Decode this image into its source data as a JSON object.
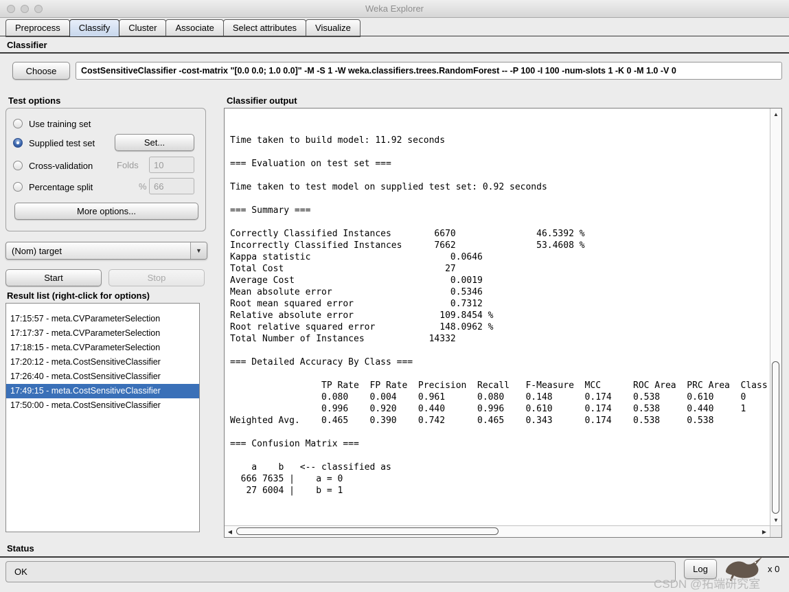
{
  "window": {
    "title": "Weka Explorer"
  },
  "tabs": {
    "items": [
      "Preprocess",
      "Classify",
      "Cluster",
      "Associate",
      "Select attributes",
      "Visualize"
    ],
    "selected": "Classify"
  },
  "classifier": {
    "section_title": "Classifier",
    "choose_label": "Choose",
    "command": "CostSensitiveClassifier -cost-matrix \"[0.0 0.0; 1.0 0.0]\" -M -S 1 -W weka.classifiers.trees.RandomForest -- -P 100 -I 100 -num-slots 1 -K 0 -M 1.0 -V 0"
  },
  "test_options": {
    "title": "Test options",
    "use_training_set": "Use training set",
    "supplied_test_set": "Supplied test set",
    "set_button": "Set...",
    "cross_validation": "Cross-validation",
    "folds_label": "Folds",
    "folds_value": "10",
    "percentage_split": "Percentage split",
    "percent_label": "%",
    "percent_value": "66",
    "more_options_button": "More options...",
    "selected_option": "Supplied test set"
  },
  "target_combo": {
    "value": "(Nom) target"
  },
  "actions": {
    "start_label": "Start",
    "stop_label": "Stop"
  },
  "result_list": {
    "title": "Result list (right-click for options)",
    "selected_index": 5,
    "items": [
      "17:15:57 - meta.CVParameterSelection",
      "17:17:37 - meta.CVParameterSelection",
      "17:18:15 - meta.CVParameterSelection",
      "17:20:12 - meta.CostSensitiveClassifier",
      "17:26:40 - meta.CostSensitiveClassifier",
      "17:49:15 - meta.CostSensitiveClassifier",
      "17:50:00 - meta.CostSensitiveClassifier"
    ]
  },
  "output": {
    "title": "Classifier output",
    "text": "Time taken to build model: 11.92 seconds\n\n=== Evaluation on test set ===\n\nTime taken to test model on supplied test set: 0.92 seconds\n\n=== Summary ===\n\nCorrectly Classified Instances        6670               46.5392 %\nIncorrectly Classified Instances      7662               53.4608 %\nKappa statistic                          0.0646\nTotal Cost                              27\nAverage Cost                             0.0019\nMean absolute error                      0.5346\nRoot mean squared error                  0.7312\nRelative absolute error                109.8454 %\nRoot relative squared error            148.0962 %\nTotal Number of Instances            14332\n\n=== Detailed Accuracy By Class ===\n\n                 TP Rate  FP Rate  Precision  Recall   F-Measure  MCC      ROC Area  PRC Area  Class\n                 0.080    0.004    0.961      0.080    0.148      0.174    0.538     0.610     0\n                 0.996    0.920    0.440      0.996    0.610      0.174    0.538     0.440     1\nWeighted Avg.    0.465    0.390    0.742      0.465    0.343      0.174    0.538     0.538\n\n=== Confusion Matrix ===\n\n    a    b   <-- classified as\n  666 7635 |    a = 0\n   27 6004 |    b = 1"
  },
  "status": {
    "title": "Status",
    "value": "OK",
    "log_label": "Log",
    "weka_count": "x 0"
  },
  "watermark": {
    "text": "CSDN @拓端研究室"
  },
  "icons": {
    "up": "▲",
    "down": "▼",
    "left": "◀",
    "right": "▶",
    "combo_arrow": "▼"
  },
  "colors": {
    "selection_blue": "#3a70b8",
    "window_bg": "#ececec",
    "output_bg": "#ffffff",
    "disabled_text": "#9b9b9b"
  }
}
